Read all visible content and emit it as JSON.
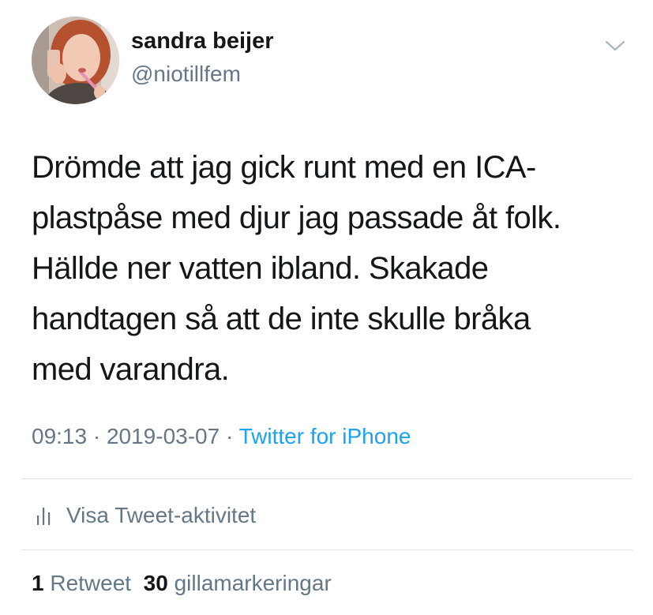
{
  "author": {
    "display_name": "sandra beijer",
    "handle": "@niotillfem",
    "avatar_icon": "profile-photo"
  },
  "menu": {
    "icon": "chevron-down-icon"
  },
  "tweet": {
    "lines": [
      "Drömde att jag gick runt med en ICA-",
      "plastpåse med djur jag passade åt folk.",
      "Hällde ner vatten ibland. Skakade",
      "handtagen så att de inte skulle bråka",
      "med varandra."
    ]
  },
  "meta": {
    "time": "09:13",
    "separator": "·",
    "date": "2019-03-07",
    "source": "Twitter for iPhone"
  },
  "activity": {
    "icon": "analytics-bars-icon",
    "label": "Visa Tweet-aktivitet"
  },
  "stats": {
    "retweet_count": "1",
    "retweet_label": "Retweet",
    "like_count": "30",
    "like_label": "gillamarkeringar"
  },
  "colors": {
    "text": "#14171a",
    "secondary": "#657786",
    "link": "#1da1f2",
    "divider": "#dde3e8"
  }
}
